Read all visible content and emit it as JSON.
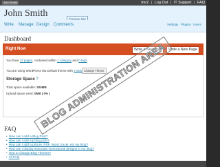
{
  "topbar": {
    "site_chip": "John Smith",
    "user": "Howdy,",
    "username": "tmr2",
    "logout": "Log Out",
    "it_support": "IT Support",
    "faq": "FAQ"
  },
  "header": {
    "blog_title": "John Smith",
    "preview_label": "Preview Site"
  },
  "nav": {
    "items": [
      "Write",
      "Manage",
      "Design",
      "Comments"
    ],
    "secondary": [
      "Settings",
      "Plugins",
      "Users"
    ]
  },
  "dashboard": {
    "title": "Dashboard",
    "right_now": {
      "label": "Right Now",
      "write_post": "Write a New Post",
      "write_page": "Write a New Page"
    },
    "stats": {
      "prefix": "You have",
      "pages": "11 pages",
      "mid": ", contained within",
      "categories": "1 category",
      "and": "and",
      "tags": "0 tags",
      "suffix": "."
    },
    "theme": {
      "prefix": "You are using WordPress Mu Default theme with",
      "widgets": "3 widgets",
      "suffix": ".",
      "change_button": "Change Theme"
    },
    "storage": {
      "title": "Storage Space",
      "help": "?",
      "total_label": "Total space available:",
      "total_value": "200MB",
      "used_label": "Upload space used:",
      "used_value": "0MB ( 0% )"
    }
  },
  "faq": {
    "title": "FAQ",
    "items": [
      "How can I add a Blog Post?",
      "How can I edit my blog post?",
      "How can I add a picture, PDF, Word, Excel, etc my blog?",
      "How can I display associate instructional designs in my blog?",
      "How to change Blog Themes?",
      "All FAQ"
    ]
  },
  "watermark": "BLOG ADMINISTRATION AREA",
  "colors": {
    "topbar": "#464646",
    "header_bg": "#e4f2fd",
    "right_now_bar": "#d54e21",
    "link": "#2583ad"
  }
}
